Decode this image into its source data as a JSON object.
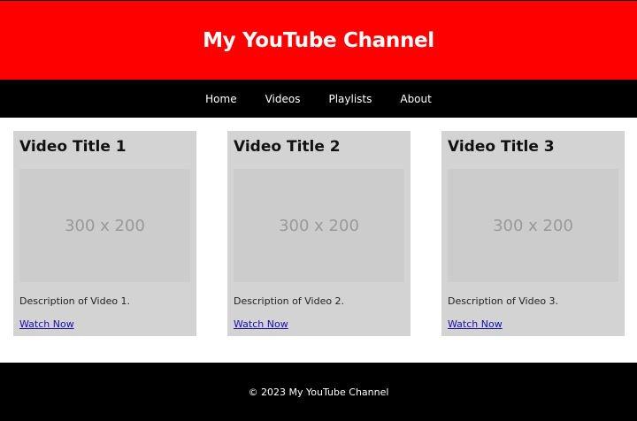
{
  "header": {
    "title": "My YouTube Channel"
  },
  "nav": {
    "items": [
      "Home",
      "Videos",
      "Playlists",
      "About"
    ]
  },
  "videos": [
    {
      "title": "Video Title 1",
      "thumbnail_text": "300 x 200",
      "description": "Description of Video 1.",
      "link_text": "Watch Now"
    },
    {
      "title": "Video Title 2",
      "thumbnail_text": "300 x 200",
      "description": "Description of Video 2.",
      "link_text": "Watch Now"
    },
    {
      "title": "Video Title 3",
      "thumbnail_text": "300 x 200",
      "description": "Description of Video 3.",
      "link_text": "Watch Now"
    }
  ],
  "footer": {
    "text": "© 2023 My YouTube Channel"
  },
  "colors": {
    "header_bg": "#ff0000",
    "nav_bg": "#000000",
    "card_bg": "#d3d3d3",
    "thumb_bg": "#cccccc",
    "link": "#1a0dab"
  }
}
